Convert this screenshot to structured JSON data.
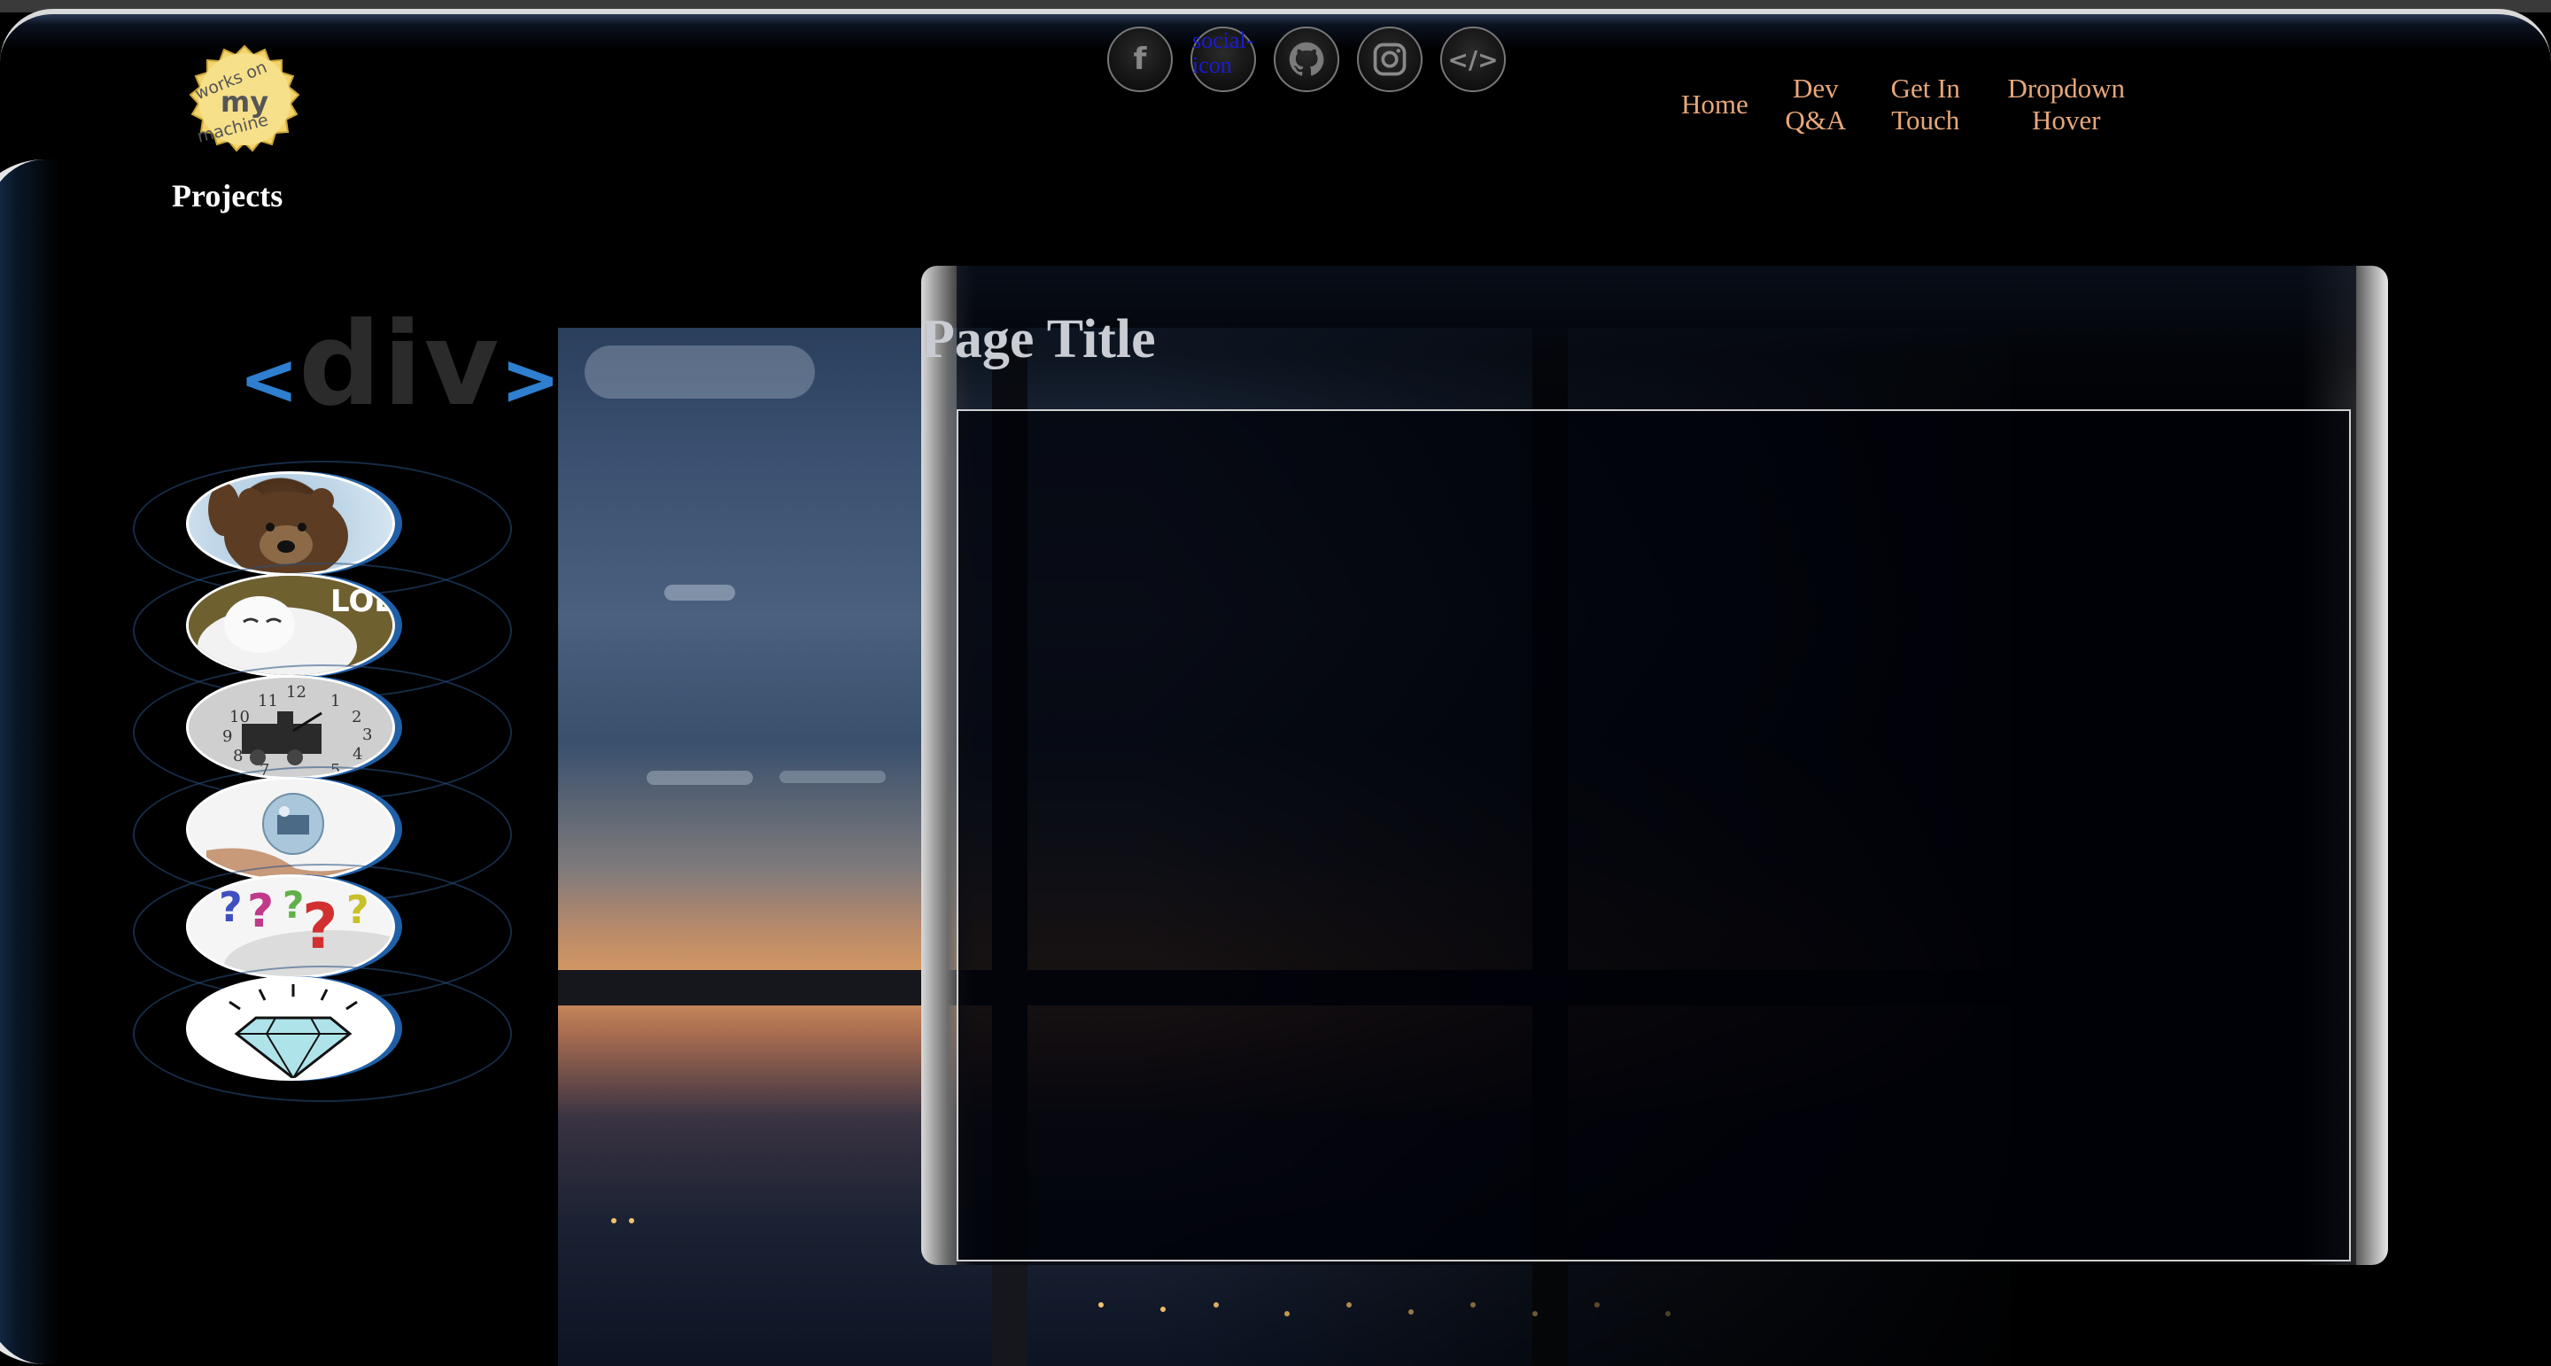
{
  "header": {
    "logo_text": [
      "works on",
      "my",
      "machine"
    ],
    "section_label": "Projects"
  },
  "social": [
    {
      "icon": "facebook-icon",
      "glyph": "f"
    },
    {
      "icon": "broken-image-icon",
      "alt": "social-icon"
    },
    {
      "icon": "github-icon",
      "glyph": ""
    },
    {
      "icon": "instagram-icon",
      "glyph": ""
    },
    {
      "icon": "code-icon",
      "glyph": "</>"
    }
  ],
  "nav": [
    {
      "label": "Home"
    },
    {
      "label": "Dev Q&A"
    },
    {
      "label": "Get In Touch"
    },
    {
      "label": "Dropdown Hover"
    }
  ],
  "brand_mark": {
    "open": "<",
    "text": "div",
    "close": ">"
  },
  "projects": [
    {
      "icon": "bear-waving-thumbnail"
    },
    {
      "icon": "cat-lol-thumbnail",
      "caption": "LOL"
    },
    {
      "icon": "clock-train-thumbnail"
    },
    {
      "icon": "crystal-ball-hand-thumbnail"
    },
    {
      "icon": "question-marks-thumbnail"
    },
    {
      "icon": "diamond-thumbnail"
    }
  ],
  "main": {
    "title": "Page Title"
  },
  "colors": {
    "nav_link": "#e7a77a",
    "accent_blue": "#2f7fd0",
    "logo_gold": "#f3d46b"
  }
}
